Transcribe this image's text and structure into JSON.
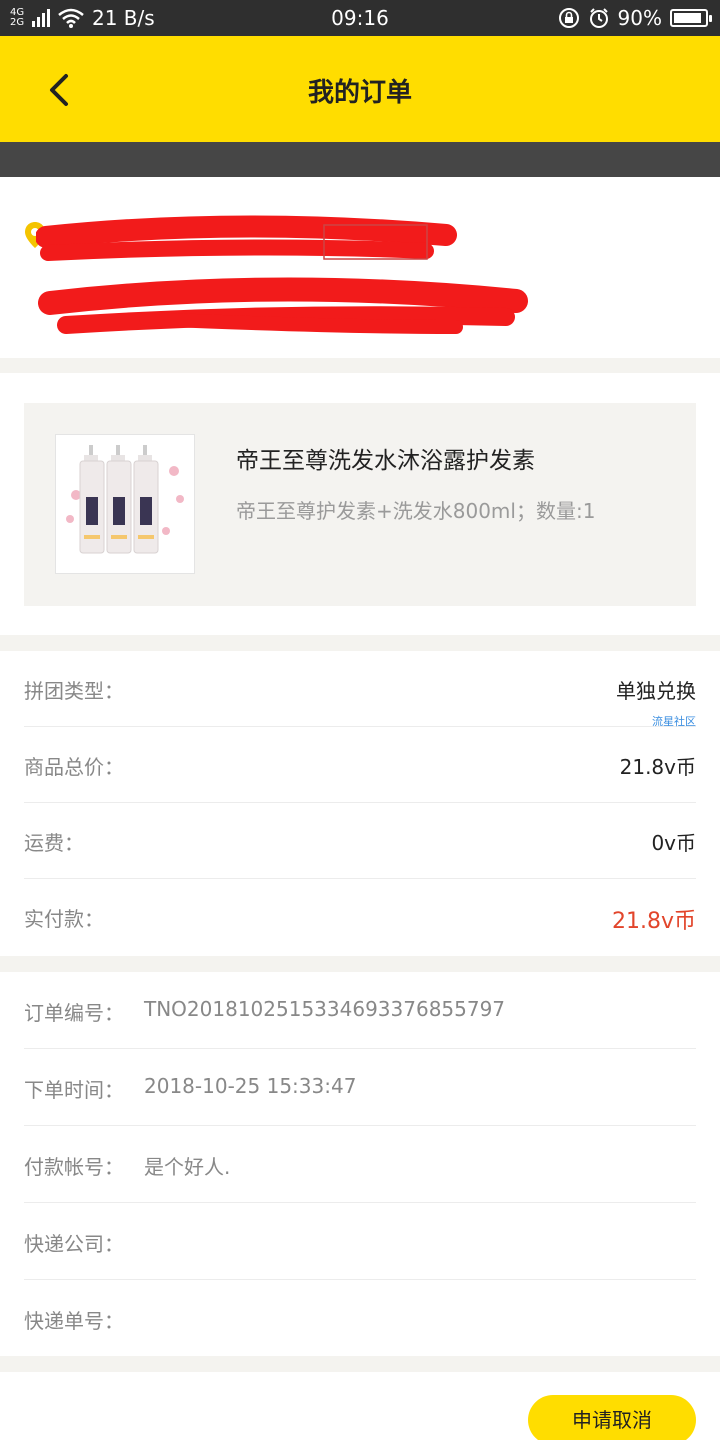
{
  "status_bar": {
    "network_top": "4G",
    "network_bottom": "2G",
    "speed": "21 B/s",
    "time": "09:16",
    "battery": "90%",
    "battery_level": 0.9,
    "icons": [
      "signal-icon",
      "wifi-icon",
      "screen-lock-icon",
      "alarm-icon",
      "battery-icon"
    ]
  },
  "header": {
    "title": "我的订单",
    "back_icon": "chevron-left-icon",
    "background": "#ffdd00"
  },
  "address": {
    "icon": "location-pin-icon",
    "redacted": true
  },
  "product": {
    "name": "帝王至尊洗发水沐浴露护发素",
    "spec": "帝王至尊护发素+洗发水800ml；数量:1"
  },
  "summary": {
    "rows": [
      {
        "label": "拼团类型：",
        "value": "单独兑换"
      },
      {
        "label": "商品总价：",
        "value": "21.8v币"
      },
      {
        "label": "运费：",
        "value": "0v币"
      },
      {
        "label": "实付款：",
        "value": "21.8v币"
      }
    ],
    "watermark": "流星社区",
    "highlight_color": "#e2452b"
  },
  "details": {
    "rows": [
      {
        "label": "订单编号：",
        "value": "TNO20181025153346933768557​97"
      },
      {
        "label": "下单时间：",
        "value": "2018-10-25 15:33:47"
      },
      {
        "label": "付款帐号：",
        "value": "是个好人."
      },
      {
        "label": "快递公司：",
        "value": ""
      },
      {
        "label": "快递单号：",
        "value": ""
      }
    ]
  },
  "actions": {
    "cancel_label": "申请取消"
  }
}
